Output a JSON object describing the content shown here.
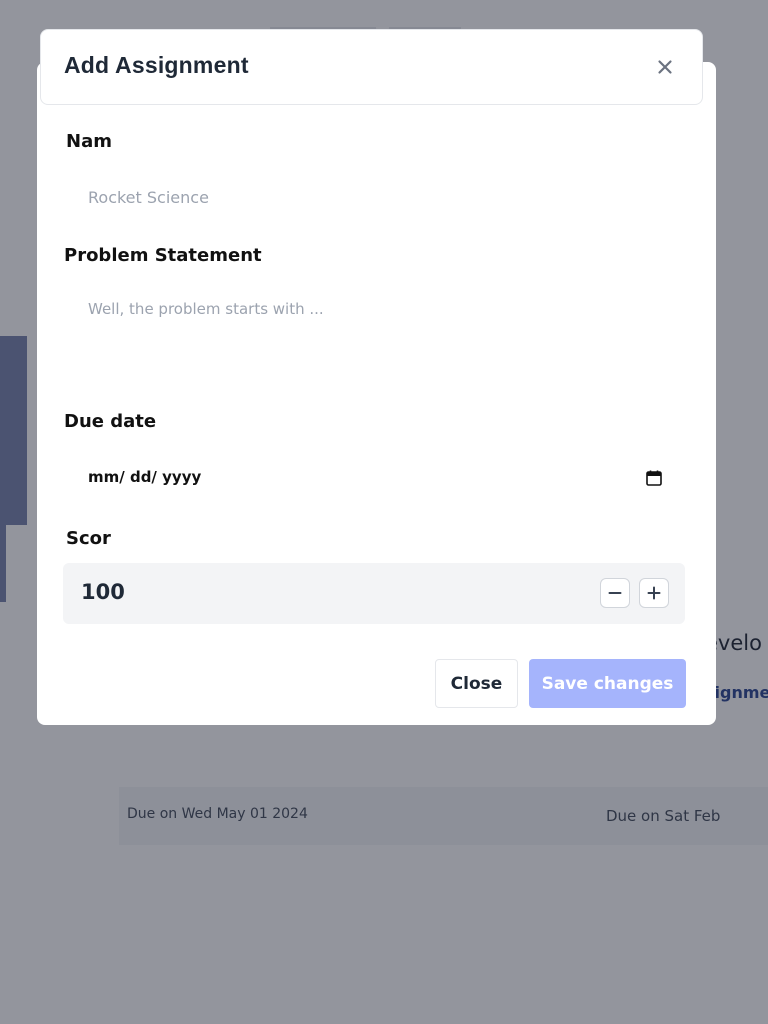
{
  "modal": {
    "title": "Add Assignment",
    "close_icon": "close-icon",
    "fields": {
      "name": {
        "label": "Nam",
        "placeholder": "Rocket Science"
      },
      "problem": {
        "label": "Problem Statement",
        "placeholder": "Well, the problem starts with ..."
      },
      "due_date": {
        "label": "Due date",
        "placeholder": "mm/ dd/ yyyy",
        "icon": "calendar-icon"
      },
      "score": {
        "label": "Scor",
        "value": "100",
        "decrement_icon": "minus-icon",
        "increment_icon": "plus-icon"
      }
    },
    "buttons": {
      "close": "Close",
      "save": "Save changes"
    }
  },
  "background": {
    "card_title_fragment": "evelo",
    "card_link_fragment": "signme",
    "due_dates": [
      "Due on Wed May 01 2024",
      "Due on Sat Feb"
    ]
  },
  "colors": {
    "overlay": "#282c3c80",
    "primary_disabled": "#a5b4fc",
    "score_bg": "#f3f4f6",
    "title_text": "#1f2937"
  }
}
